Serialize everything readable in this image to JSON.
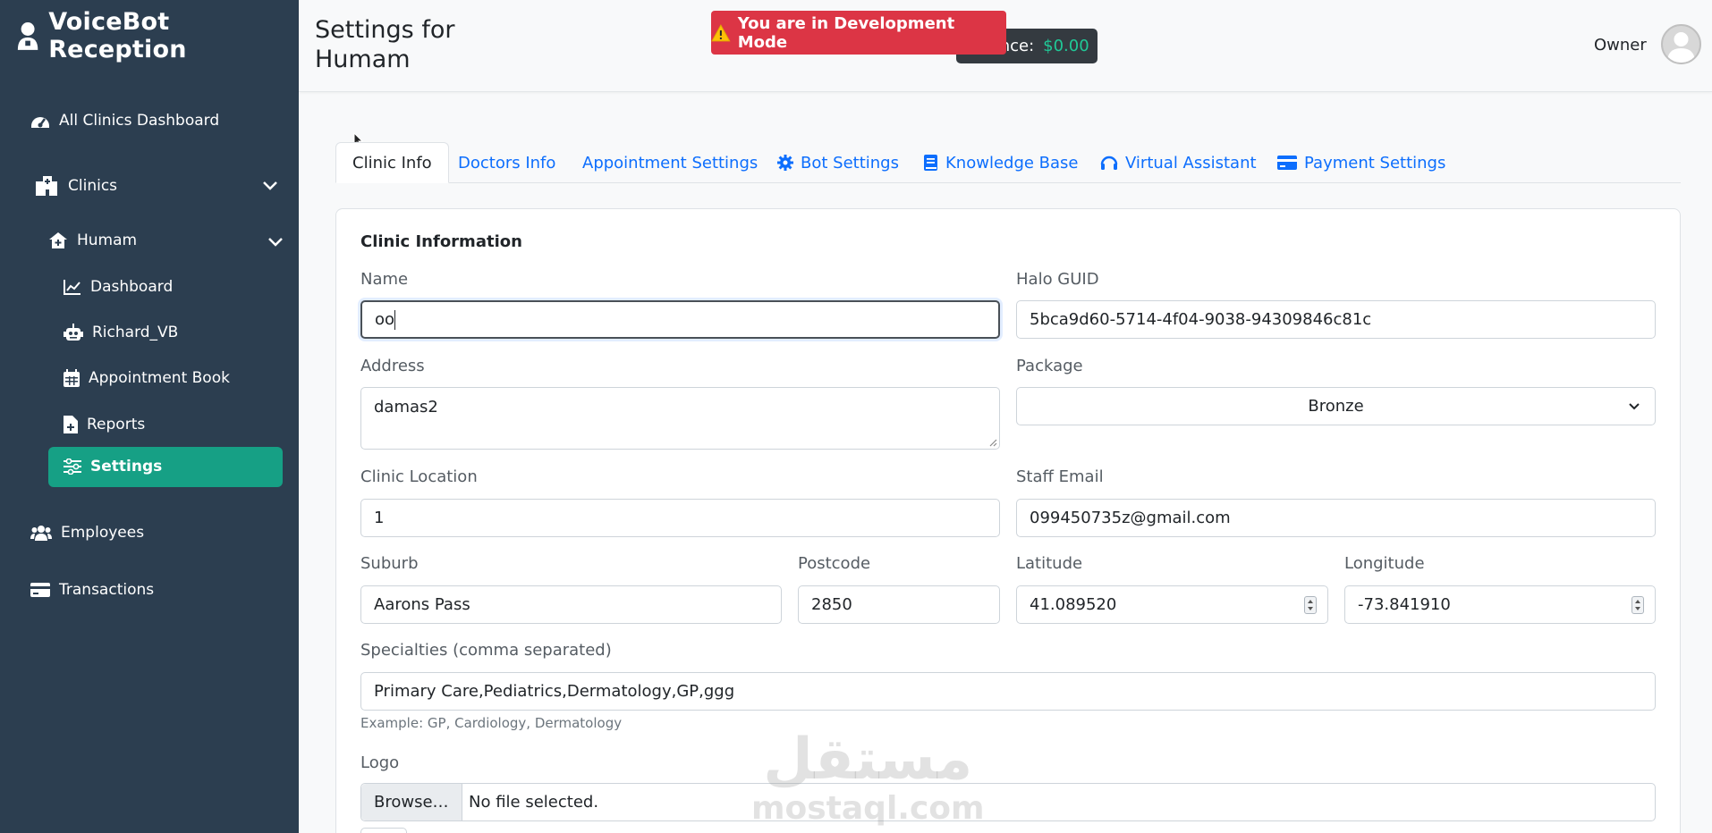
{
  "sidebar": {
    "brand": "VoiceBot Reception",
    "items": {
      "all_clinics": "All Clinics Dashboard",
      "clinics": "Clinics",
      "humam": "Humam",
      "dashboard": "Dashboard",
      "richard": "Richard_VB",
      "appointment_book": "Appointment Book",
      "reports": "Reports",
      "settings": "Settings",
      "employees": "Employees",
      "transactions": "Transactions"
    },
    "active_color": "#16a085"
  },
  "header": {
    "title": "Settings for Humam",
    "balance_label": "Balance:",
    "balance_value": "$0.00",
    "dev_mode": "You are in Development Mode",
    "user": "Owner"
  },
  "tabs": [
    "Clinic Info",
    "Doctors Info",
    "Appointment Settings",
    "Bot Settings",
    "Knowledge Base",
    "Virtual Assistant",
    "Payment Settings"
  ],
  "form": {
    "section_title": "Clinic Information",
    "name_label": "Name",
    "name_value": "oo",
    "halo_label": "Halo GUID",
    "halo_value": "5bca9d60-5714-4f04-9038-94309846c81c",
    "address_label": "Address",
    "address_value": "damas2",
    "package_label": "Package",
    "package_value": "Bronze",
    "location_label": "Clinic Location",
    "location_value": "1",
    "staff_email_label": "Staff Email",
    "staff_email_value": "099450735z@gmail.com",
    "suburb_label": "Suburb",
    "suburb_value": "Aarons Pass",
    "postcode_label": "Postcode",
    "postcode_value": "2850",
    "latitude_label": "Latitude",
    "latitude_value": "41.089520",
    "longitude_label": "Longitude",
    "longitude_value": "-73.841910",
    "specialties_label": "Specialties (comma separated)",
    "specialties_value": "Primary Care,Pediatrics,Dermatology,GP,ggg",
    "specialties_hint": "Example: GP, Cardiology, Dermatology",
    "logo_label": "Logo",
    "browse_label": "Browse…",
    "no_file": "No file selected."
  },
  "watermark": {
    "arabic": "مستقل",
    "latin": "mostaql.com"
  }
}
